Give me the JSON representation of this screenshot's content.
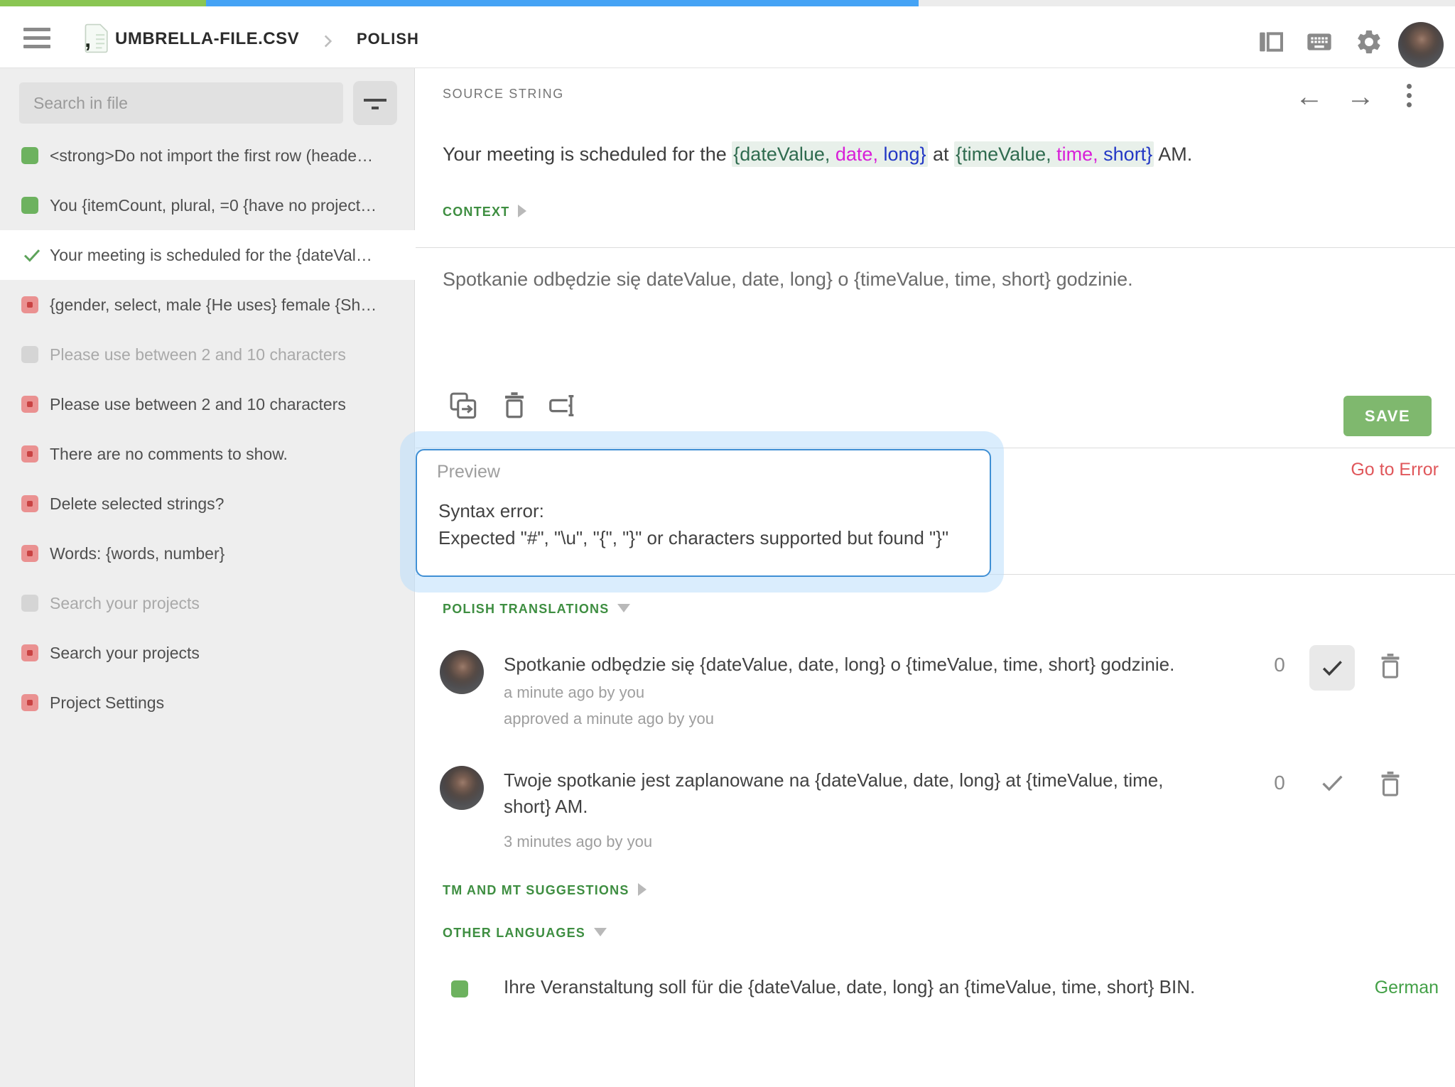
{
  "palette": {
    "accent_green": "#3e8e41",
    "progress_green": "#8ac653",
    "progress_blue": "#45a3f5",
    "save_green": "#7fb86e",
    "error_red": "#e0575b",
    "placeholder_green": "#2f6b4f",
    "placeholder_magenta": "#d81fd8",
    "placeholder_blue": "#2338c5",
    "placeholder_highlight": "#e8f0ea"
  },
  "header": {
    "file_name": "UMBRELLA-FILE.CSV",
    "language_crumb": "POLISH",
    "icons": [
      "hamburger-menu",
      "csv-file",
      "side-panel",
      "keyboard-shortcuts",
      "settings-gear",
      "user-avatar"
    ]
  },
  "sidebar": {
    "search_placeholder": "Search in file",
    "items": [
      {
        "status": "translated",
        "label": "<strong>Do not import the first row (heade…"
      },
      {
        "status": "translated",
        "label": "You {itemCount, plural, =0 {have no project…"
      },
      {
        "status": "approved-selected",
        "label": "Your meeting is scheduled for the {dateVal…"
      },
      {
        "status": "untranslated",
        "label": "{gender, select, male {He uses} female {Sh…"
      },
      {
        "status": "hidden",
        "label": "Please use between 2 and 10 characters"
      },
      {
        "status": "untranslated",
        "label": "Please use between 2 and 10 characters"
      },
      {
        "status": "untranslated",
        "label": "There are no comments to show."
      },
      {
        "status": "untranslated",
        "label": "Delete selected strings?"
      },
      {
        "status": "untranslated",
        "label": "Words: {words, number}"
      },
      {
        "status": "hidden",
        "label": "Search your projects"
      },
      {
        "status": "untranslated",
        "label": "Search your projects"
      },
      {
        "status": "untranslated",
        "label": "Project Settings"
      }
    ]
  },
  "source": {
    "section_label": "SOURCE STRING",
    "prefix": "Your meeting is scheduled for the ",
    "ph1_green": "{dateValue,",
    "ph1_magenta": " date,",
    "ph1_blue": " long}",
    "mid": " at ",
    "ph2_green": "{timeValue,",
    "ph2_magenta": " time,",
    "ph2_blue": " short}",
    "suffix": " AM.",
    "context_label": "CONTEXT"
  },
  "editor": {
    "translation_text": "Spotkanie odbędzie się dateValue, date, long} o {timeValue, time, short} godzinie.",
    "save_label": "SAVE",
    "go_to_error_label": "Go to Error"
  },
  "preview": {
    "title": "Preview",
    "error_line1": "Syntax error:",
    "error_line2": "Expected \"#\", \"\\u\", \"{\", \"}\" or characters supported but found \"}\""
  },
  "translations": {
    "section_label": "POLISH TRANSLATIONS",
    "entries": [
      {
        "text": "Spotkanie odbędzie się {dateValue, date, long} o {timeValue, time, short} godzinie.",
        "meta_line1": "a minute ago by you",
        "meta_line2": "approved a minute ago by you",
        "votes": "0",
        "approved": true
      },
      {
        "text": "Twoje spotkanie jest zaplanowane na {dateValue, date, long} at {timeValue, time,\nshort} AM.",
        "meta_line1": "3 minutes ago by you",
        "votes": "0",
        "approved": false
      }
    ]
  },
  "tm_section": {
    "label": "TM AND MT SUGGESTIONS"
  },
  "other_languages": {
    "label": "OTHER LANGUAGES",
    "rows": [
      {
        "text": "Ihre Veranstaltung soll für die {dateValue, date, long} an {timeValue, time, short} BIN.",
        "language": "German"
      }
    ]
  }
}
